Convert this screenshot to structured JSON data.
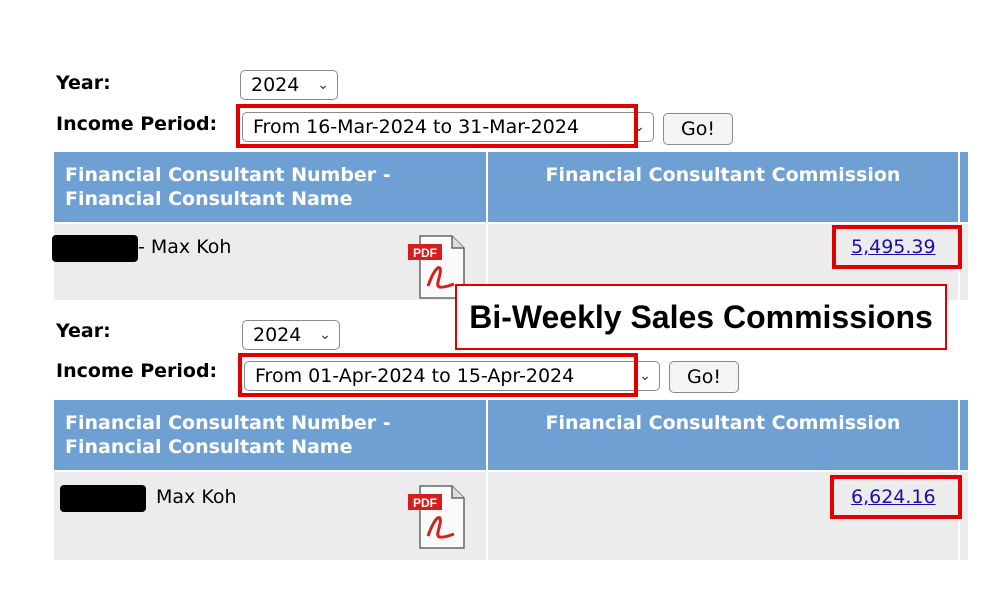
{
  "periods": [
    {
      "year_label": "Year:",
      "year_value": "2024",
      "income_period_label": "Income Period:",
      "income_period_value": "From 16-Mar-2024 to 31-Mar-2024",
      "go_label": "Go!",
      "col_consultant_header": "Financial Consultant Number - Financial Consultant Name",
      "col_commission_header": "Financial Consultant Commission",
      "consultant_name": "- Max Koh",
      "commission_amount": "5,495.39",
      "pdf_badge": "PDF"
    },
    {
      "year_label": "Year:",
      "year_value": "2024",
      "income_period_label": "Income Period:",
      "income_period_value": "From 01-Apr-2024 to 15-Apr-2024",
      "go_label": "Go!",
      "col_consultant_header": "Financial Consultant Number - Financial Consultant Name",
      "col_commission_header": "Financial Consultant Commission",
      "consultant_name": "Max Koh",
      "commission_amount": "6,624.16",
      "pdf_badge": "PDF"
    }
  ],
  "callout": {
    "text": "Bi-Weekly Sales Commissions"
  },
  "icons": {
    "dropdown": "chevron-down-icon",
    "pdf": "adobe-pdf-icon"
  },
  "colors": {
    "header_bg": "#6fa0d3",
    "row_bg": "#ececec",
    "highlight": "#e00000",
    "link": "#1a0dab"
  }
}
